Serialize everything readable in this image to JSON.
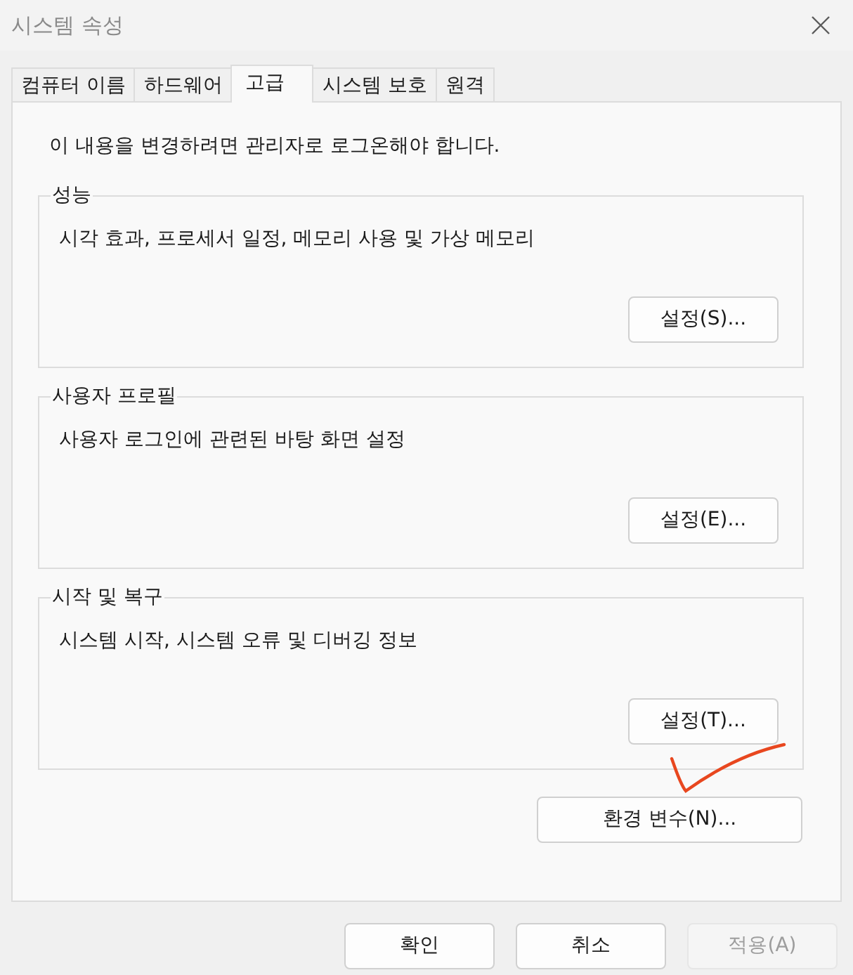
{
  "window": {
    "title": "시스템 속성"
  },
  "tabs": [
    {
      "label": "컴퓨터 이름",
      "selected": false
    },
    {
      "label": "하드웨어",
      "selected": false
    },
    {
      "label": "고급",
      "selected": true
    },
    {
      "label": "시스템 보호",
      "selected": false
    },
    {
      "label": "원격",
      "selected": false
    }
  ],
  "notice": "이 내용을 변경하려면 관리자로 로그온해야 합니다.",
  "groups": [
    {
      "title": "성능",
      "description": "시각 효과, 프로세서 일정, 메모리 사용 및 가상 메모리",
      "button": "설정(S)..."
    },
    {
      "title": "사용자 프로필",
      "description": "사용자 로그인에 관련된 바탕 화면 설정",
      "button": "설정(E)..."
    },
    {
      "title": "시작 및 복구",
      "description": "시스템 시작, 시스템 오류 및 디버깅 정보",
      "button": "설정(T)..."
    }
  ],
  "environment_button": "환경 변수(N)...",
  "buttons": [
    {
      "label": "확인",
      "disabled": false
    },
    {
      "label": "취소",
      "disabled": false
    },
    {
      "label": "적용(A)",
      "disabled": true
    }
  ]
}
